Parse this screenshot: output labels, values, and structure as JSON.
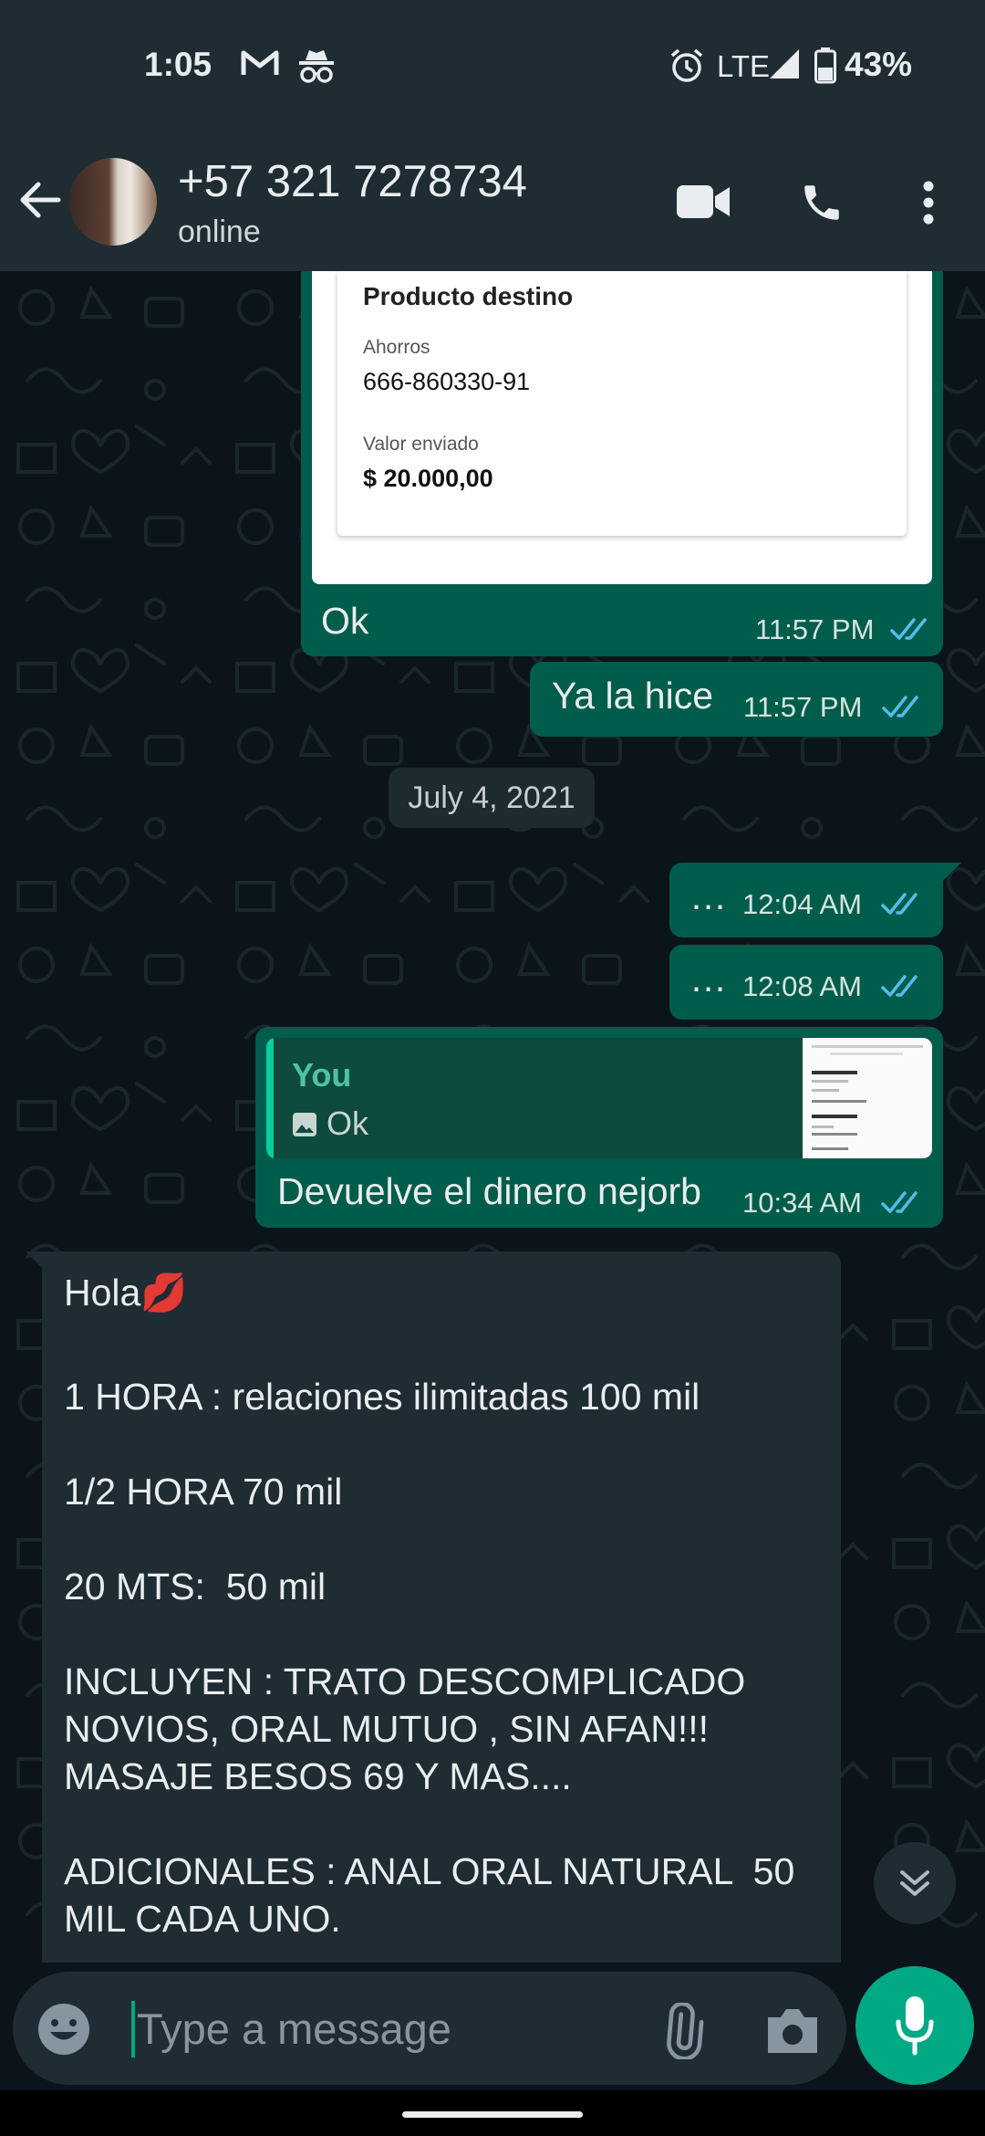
{
  "status_bar": {
    "time": "1:05",
    "network": "LTE",
    "battery": "43%",
    "icons": [
      "gmail-icon",
      "incognito-icon",
      "alarm-icon",
      "signal-icon",
      "battery-icon"
    ]
  },
  "header": {
    "contact_name": "+57 321 7278734",
    "contact_status": "online",
    "icons": [
      "back-arrow-icon",
      "video-call-icon",
      "voice-call-icon",
      "more-options-icon"
    ]
  },
  "messages": {
    "receipt": {
      "heading": "Producto destino",
      "account_label": "Ahorros",
      "account_value": "666-860330-91",
      "amount_label": "Valor enviado",
      "amount_value": "$ 20.000,00",
      "caption": "Ok",
      "time": "11:57 PM"
    },
    "msg_ya": {
      "text": "Ya la hice",
      "time": "11:57 PM"
    },
    "date_divider": "July 4, 2021",
    "msg_dots1": {
      "text": "…",
      "time": "12:04 AM"
    },
    "msg_dots2": {
      "text": "…",
      "time": "12:08 AM"
    },
    "reply": {
      "quote_author": "You",
      "quote_text": "Ok",
      "text": "Devuelve el dinero nejorb",
      "time": "10:34 AM"
    },
    "incoming": {
      "line1": "Hola💋",
      "line2": "1 HORA : relaciones ilimitadas 100 mil",
      "line3": "1/2 HORA 70 mil",
      "line4": "20 MTS:  50 mil",
      "line5": "INCLUYEN : TRATO DESCOMPLICADO",
      "line6": "NOVIOS, ORAL MUTUO , SIN AFAN!!!",
      "line7": "MASAJE BESOS 69 Y MAS....",
      "line8": "ADICIONALES : ANAL ORAL NATURAL  50",
      "line9": "MIL CADA UNO."
    }
  },
  "composer": {
    "placeholder": "Type a message",
    "icons": [
      "emoji-icon",
      "attach-icon",
      "camera-icon",
      "mic-icon"
    ]
  },
  "colors": {
    "outgoing_bubble": "#005c4b",
    "incoming_bubble": "#202c33",
    "accent": "#00a884",
    "read_ticks": "#53bdeb"
  }
}
